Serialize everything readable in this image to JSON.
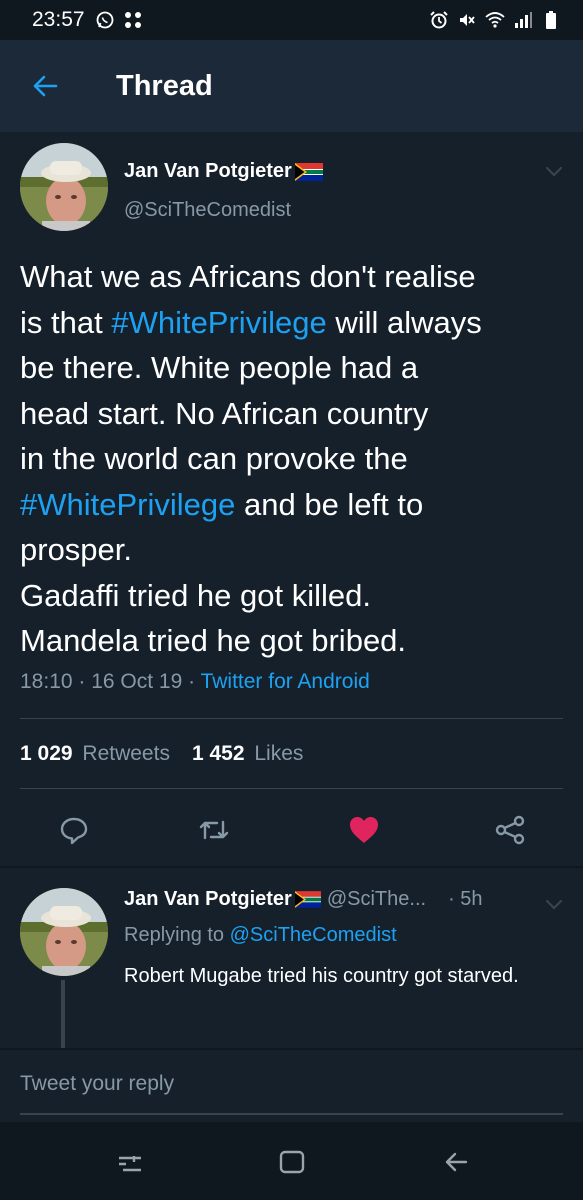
{
  "status_bar": {
    "time": "23:57",
    "left_icons": [
      "whatsapp-icon",
      "apps-icon"
    ],
    "right_icons": [
      "alarm-icon",
      "mute-icon",
      "wifi-icon",
      "signal-icon",
      "battery-icon"
    ]
  },
  "app_bar": {
    "title": "Thread",
    "back_icon": "back-arrow-icon"
  },
  "main_tweet": {
    "author_name": "Jan Van Potgieter",
    "author_flag": "south-africa-flag-icon",
    "author_handle": "@SciTheComedist",
    "body": {
      "l1": "What we as Africans don't realise",
      "l2_a": "is that ",
      "l2_tag": "#WhitePrivilege",
      "l2_b": " will always",
      "l3": "be there. White people had a",
      "l4": "head start. No African country",
      "l5": "in the world can provoke the",
      "l6_tag": "#WhitePrivilege",
      "l6_b": " and be left to",
      "l7": "prosper.",
      "l8": "Gadaffi tried he got killed.",
      "l9": "Mandela tried he got bribed."
    },
    "timestamp": "18:10 · 16 Oct 19 · ",
    "source": "Twitter for Android",
    "retweets_count": "1 029",
    "retweets_label": "Retweets",
    "likes_count": "1 452",
    "likes_label": "Likes",
    "actions": [
      "reply-icon",
      "retweet-icon",
      "like-icon",
      "share-icon"
    ],
    "liked_color": "#e0245e"
  },
  "reply_tweet": {
    "author_name": "Jan Van Potgieter",
    "author_handle": "@SciThe...",
    "time": "· 5h",
    "replying_prefix": "Replying to ",
    "replying_mention": "@SciTheComedist",
    "text": "Robert Mugabe tried his country got starved."
  },
  "reply_box": {
    "placeholder": "Tweet your reply"
  },
  "nav_bar": {
    "buttons": [
      "recents-icon",
      "home-icon",
      "back-icon"
    ]
  },
  "colors": {
    "background": "#15202b",
    "app_bar": "#1c2938",
    "accent": "#1da1f2",
    "secondary_text": "#8899a6"
  }
}
